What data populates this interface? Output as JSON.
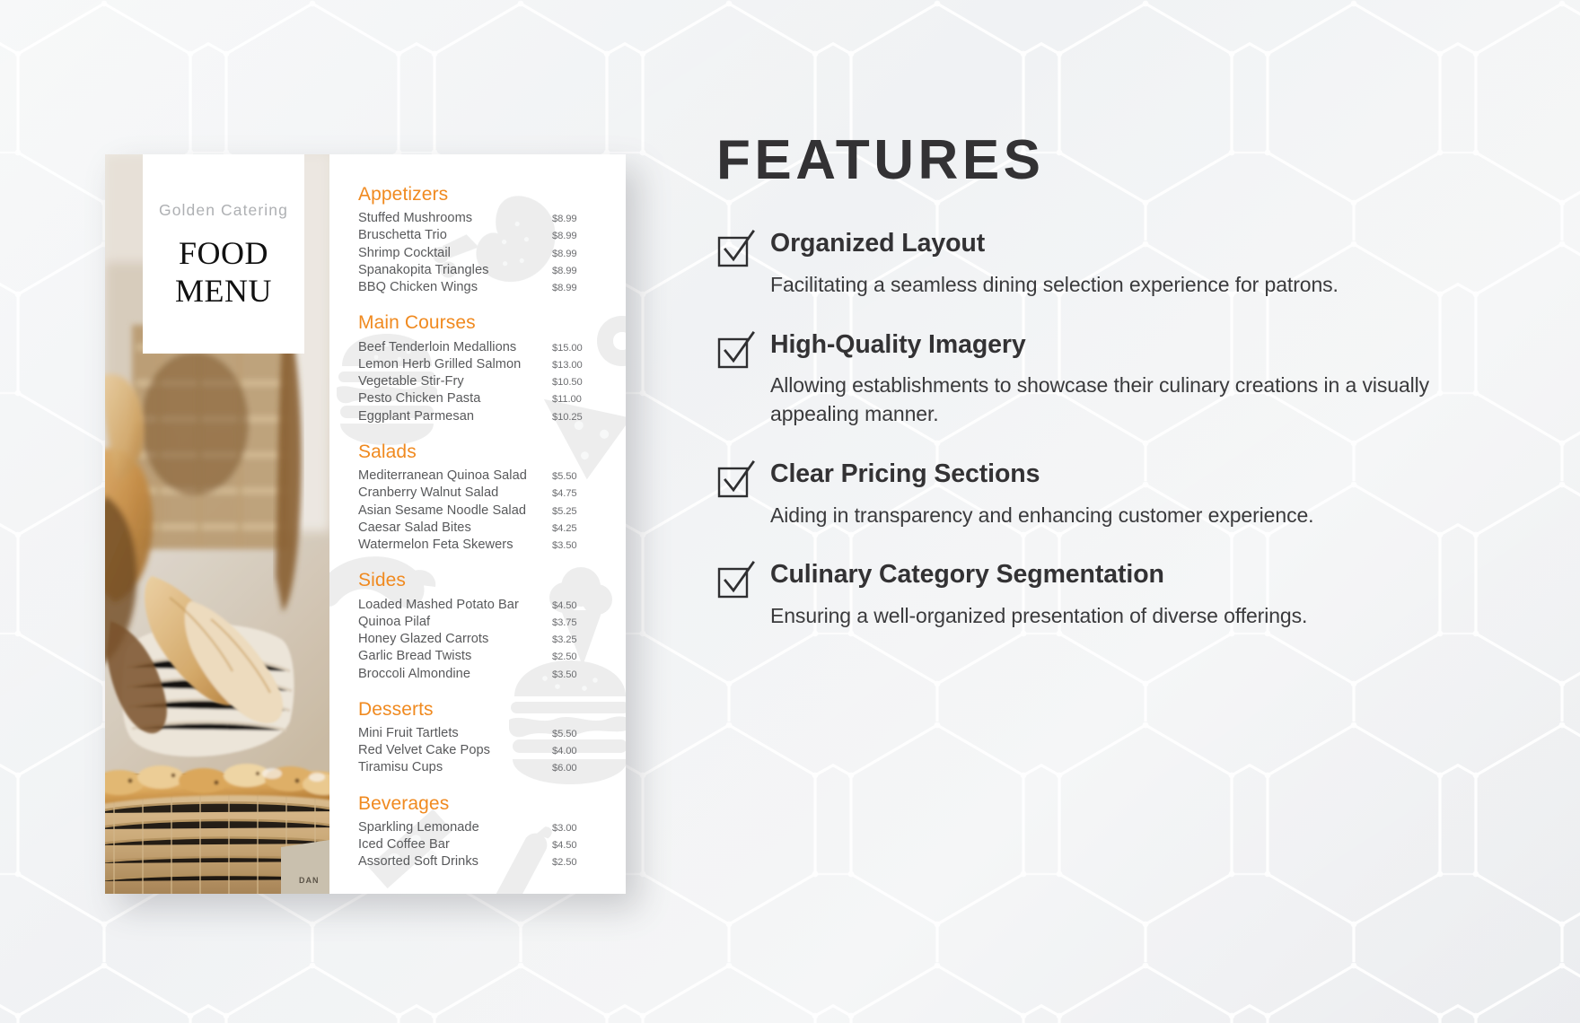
{
  "background": {
    "base_color": "#f2f3f5",
    "pattern": "hexagon-lattice"
  },
  "menu_card": {
    "brand_name": "Golden Catering",
    "title_line1": "FOOD",
    "title_line2": "MENU",
    "accent_color": "#f08a20",
    "photo_alt": "bread-loaves-and-pastries-in-wicker-baskets",
    "sections": [
      {
        "title": "Appetizers",
        "items": [
          {
            "name": "Stuffed Mushrooms",
            "price": "$8.99"
          },
          {
            "name": "Bruschetta Trio",
            "price": "$8.99"
          },
          {
            "name": "Shrimp Cocktail",
            "price": "$8.99"
          },
          {
            "name": "Spanakopita Triangles",
            "price": "$8.99"
          },
          {
            "name": "BBQ Chicken Wings",
            "price": "$8.99"
          }
        ]
      },
      {
        "title": "Main Courses",
        "items": [
          {
            "name": "Beef Tenderloin Medallions",
            "price": "$15.00"
          },
          {
            "name": "Lemon Herb Grilled Salmon",
            "price": "$13.00"
          },
          {
            "name": "Vegetable Stir-Fry",
            "price": "$10.50"
          },
          {
            "name": "Pesto Chicken Pasta",
            "price": "$11.00"
          },
          {
            "name": "Eggplant Parmesan",
            "price": "$10.25"
          }
        ]
      },
      {
        "title": "Salads",
        "items": [
          {
            "name": "Mediterranean Quinoa Salad",
            "price": "$5.50"
          },
          {
            "name": "Cranberry Walnut Salad",
            "price": "$4.75"
          },
          {
            "name": "Asian Sesame Noodle Salad",
            "price": "$5.25"
          },
          {
            "name": "Caesar Salad Bites",
            "price": "$4.25"
          },
          {
            "name": "Watermelon Feta Skewers",
            "price": "$3.50"
          }
        ]
      },
      {
        "title": "Sides",
        "items": [
          {
            "name": "Loaded Mashed Potato Bar",
            "price": "$4.50"
          },
          {
            "name": "Quinoa Pilaf",
            "price": "$3.75"
          },
          {
            "name": "Honey Glazed Carrots",
            "price": "$3.25"
          },
          {
            "name": "Garlic Bread Twists",
            "price": "$2.50"
          },
          {
            "name": "Broccoli Almondine",
            "price": "$3.50"
          }
        ]
      },
      {
        "title": "Desserts",
        "items": [
          {
            "name": "Mini Fruit Tartlets",
            "price": "$5.50"
          },
          {
            "name": "Red Velvet Cake Pops",
            "price": "$4.00"
          },
          {
            "name": "Tiramisu Cups",
            "price": "$6.00"
          }
        ]
      },
      {
        "title": "Beverages",
        "items": [
          {
            "name": "Sparkling Lemonade",
            "price": "$3.00"
          },
          {
            "name": "Iced Coffee Bar",
            "price": "$4.50"
          },
          {
            "name": "Assorted Soft Drinks",
            "price": "$2.50"
          }
        ]
      }
    ]
  },
  "features": {
    "heading": "FEATURES",
    "heading_color": "#333234",
    "items": [
      {
        "icon": "checkbox-checked-icon",
        "title": "Organized Layout",
        "description": "Facilitating a seamless dining selection experience for patrons."
      },
      {
        "icon": "checkbox-checked-icon",
        "title": "High-Quality Imagery",
        "description": "Allowing establishments to showcase their culinary creations in a visually appealing manner."
      },
      {
        "icon": "checkbox-checked-icon",
        "title": "Clear Pricing Sections",
        "description": "Aiding in transparency and enhancing customer experience."
      },
      {
        "icon": "checkbox-checked-icon",
        "title": "Culinary Category Segmentation",
        "description": "Ensuring a well-organized presentation of diverse offerings."
      }
    ]
  }
}
